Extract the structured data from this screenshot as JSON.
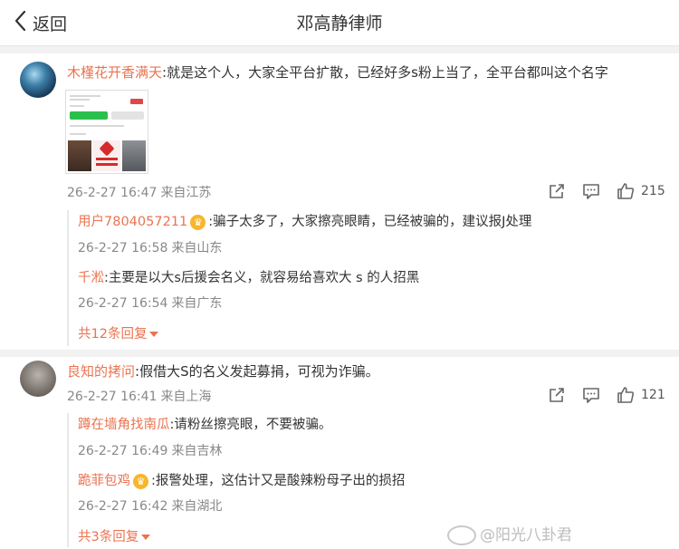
{
  "nav": {
    "back_label": "返回",
    "title": "邓高静律师"
  },
  "comments": [
    {
      "user": "木槿花开香满天",
      "text": ":就是这个人，大家全平台扩散，已经好多s粉上当了，全平台都叫这个名字",
      "time": "26-2-27 16:47",
      "location": "来自江苏",
      "likes": "215",
      "replies": [
        {
          "user": "用户7804057211",
          "text": ":骗子太多了，大家擦亮眼睛，已经被骗的，建议报J处理",
          "time": "26-2-27 16:58",
          "location": "来自山东"
        },
        {
          "user": "千淞",
          "text": ":主要是以大s后援会名义，就容易给喜欢大 s 的人招黑",
          "time": "26-2-27 16:54",
          "location": "来自广东"
        }
      ],
      "more_replies": "共12条回复"
    },
    {
      "user": "良知的拷问",
      "text": ":假借大S的名义发起募捐，可视为诈骗。",
      "time": "26-2-27 16:41",
      "location": "来自上海",
      "likes": "121",
      "replies": [
        {
          "user": "蹲在墙角找南瓜",
          "text": ":请粉丝擦亮眼，不要被骗。",
          "time": "26-2-27 16:49",
          "location": "来自吉林"
        },
        {
          "user": "跪菲包鸡",
          "text": ":报警处理，这估计又是酸辣粉母子出的损招",
          "time": "26-2-27 16:42",
          "location": "来自湖北"
        }
      ],
      "more_replies": "共3条回复"
    }
  ],
  "badge_glyph": "♛",
  "watermark": "@阳光八卦君",
  "colors": {
    "username": "#eb7350",
    "meta": "#888888",
    "separator": "#f2f2f2"
  },
  "icons": [
    "chevron-left-icon",
    "share-icon",
    "comment-icon",
    "like-icon",
    "crown-badge-icon",
    "caret-down-icon",
    "weibo-logo-icon"
  ]
}
